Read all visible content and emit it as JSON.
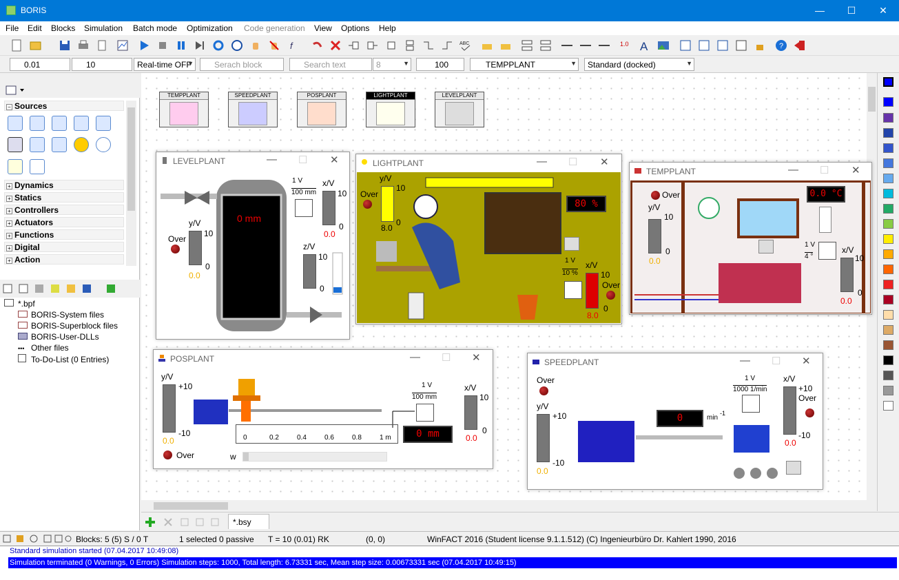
{
  "app": {
    "title": "BORIS"
  },
  "menu": [
    "File",
    "Edit",
    "Blocks",
    "Simulation",
    "Batch mode",
    "Optimization",
    "Code generation",
    "View",
    "Options",
    "Help"
  ],
  "toolbar2": {
    "step": "0.01",
    "endtime": "10",
    "mode": "Real-time OFF",
    "search_block": "Serach block",
    "search_text": "Search text",
    "font_size": "8",
    "zoom": "100",
    "block_select": "TEMPPLANT",
    "dock": "Standard (docked)"
  },
  "sidebar": {
    "categories": [
      "Sources",
      "Dynamics",
      "Statics",
      "Controllers",
      "Actuators",
      "Functions",
      "Digital",
      "Action"
    ]
  },
  "project": {
    "root": "*.bpf",
    "items": [
      "BORIS-System files",
      "BORIS-Superblock files",
      "BORIS-User-DLLs",
      "Other files",
      "To-Do-List (0 Entries)"
    ]
  },
  "blocks": [
    "TEMPPLANT",
    "SPEEDPLANT",
    "POSPLANT",
    "LIGHTPLANT",
    "LEVELPLANT"
  ],
  "windows": {
    "levelplant": {
      "title": "LEVELPLANT",
      "gain_top": "1 V",
      "gain_bot": "100 mm",
      "xv": "x/V",
      "x_max": "10",
      "x_zero": "0",
      "x_val": "0.0",
      "yv": "y/V",
      "y_max": "10",
      "y_zero": "0",
      "y_val": "0.0",
      "over": "Over",
      "display": "0 mm",
      "zv": "z/V",
      "z_max": "10",
      "z_zero": "0"
    },
    "lightplant": {
      "title": "LIGHTPLANT",
      "yv": "y/V",
      "y_max": "10",
      "y_zero": "0",
      "y_val": "8.0",
      "over": "Over",
      "display": "80 %",
      "gain_top": "1 V",
      "gain_bot": "10 %",
      "xv": "x/V",
      "x_max": "10",
      "x_zero": "0",
      "x_val": "8.0",
      "over2": "Over"
    },
    "tempplant": {
      "title": "TEMPPLANT",
      "over": "Over",
      "yv": "y/V",
      "y_max": "10",
      "y_zero": "0",
      "y_val": "0.0",
      "display": "0.0 °C",
      "gain_top": "1 V",
      "gain_bot": "4 °",
      "xv": "x/V",
      "x_max": "10",
      "x_zero": "0",
      "x_val": "0.0"
    },
    "posplant": {
      "title": "POSPLANT",
      "yv": "y/V",
      "y_max": "+10",
      "y_min": "-10",
      "y_val": "0.0",
      "over": "Over",
      "gain_top": "1 V",
      "gain_bot": "100 mm",
      "xv": "x/V",
      "x_max": "10",
      "x_zero": "0",
      "x_val": "0.0",
      "scale": [
        "0",
        "0.2",
        "0.4",
        "0.6",
        "0.8",
        "1 m"
      ],
      "display": "0 mm",
      "w": "w"
    },
    "speedplant": {
      "title": "SPEEDPLANT",
      "over": "Over",
      "yv": "y/V",
      "y_max": "+10",
      "y_min": "-10",
      "y_val": "0.0",
      "display": "0",
      "unit": "min",
      "unit_exp": "-1",
      "gain_top": "1 V",
      "gain_bot": "1000 1/min",
      "xv": "x/V",
      "x_max": "+10",
      "x_min": "-10",
      "x_val": "0.0",
      "over2": "Over"
    }
  },
  "tab": {
    "label": "*.bsy"
  },
  "status": {
    "blocks": "Blocks: 5 (5) S / 0 T",
    "selected": "1 selected  0 passive",
    "time": "T = 10  (0.01)  RK",
    "coords": "(0, 0)",
    "license": "WinFACT 2016 (Student license 9.1.1.512)  (C) Ingenieurbüro Dr. Kahlert 1990, 2016"
  },
  "log": {
    "line1": "Standard simulation started    (07.04.2017 10:49:08)",
    "line2": "Simulation terminated (0 Warnings, 0 Errors)    Simulation steps: 1000, Total length:    6.73331 sec, Mean step size: 0.00673331 sec    (07.04.2017 10:49:15)"
  },
  "palette": [
    "#0000ff",
    "#0000ff",
    "#6633aa",
    "#2244aa",
    "#3355cc",
    "#4477dd",
    "#66aaee",
    "#00bbdd",
    "#22aa66",
    "#88cc44",
    "#ffee00",
    "#ffaa00",
    "#ff6600",
    "#ee2222",
    "#aa0022",
    "#ffddaa",
    "#ddaa66",
    "#995533",
    "#000000",
    "#555555",
    "#999999",
    "#ffffff"
  ]
}
